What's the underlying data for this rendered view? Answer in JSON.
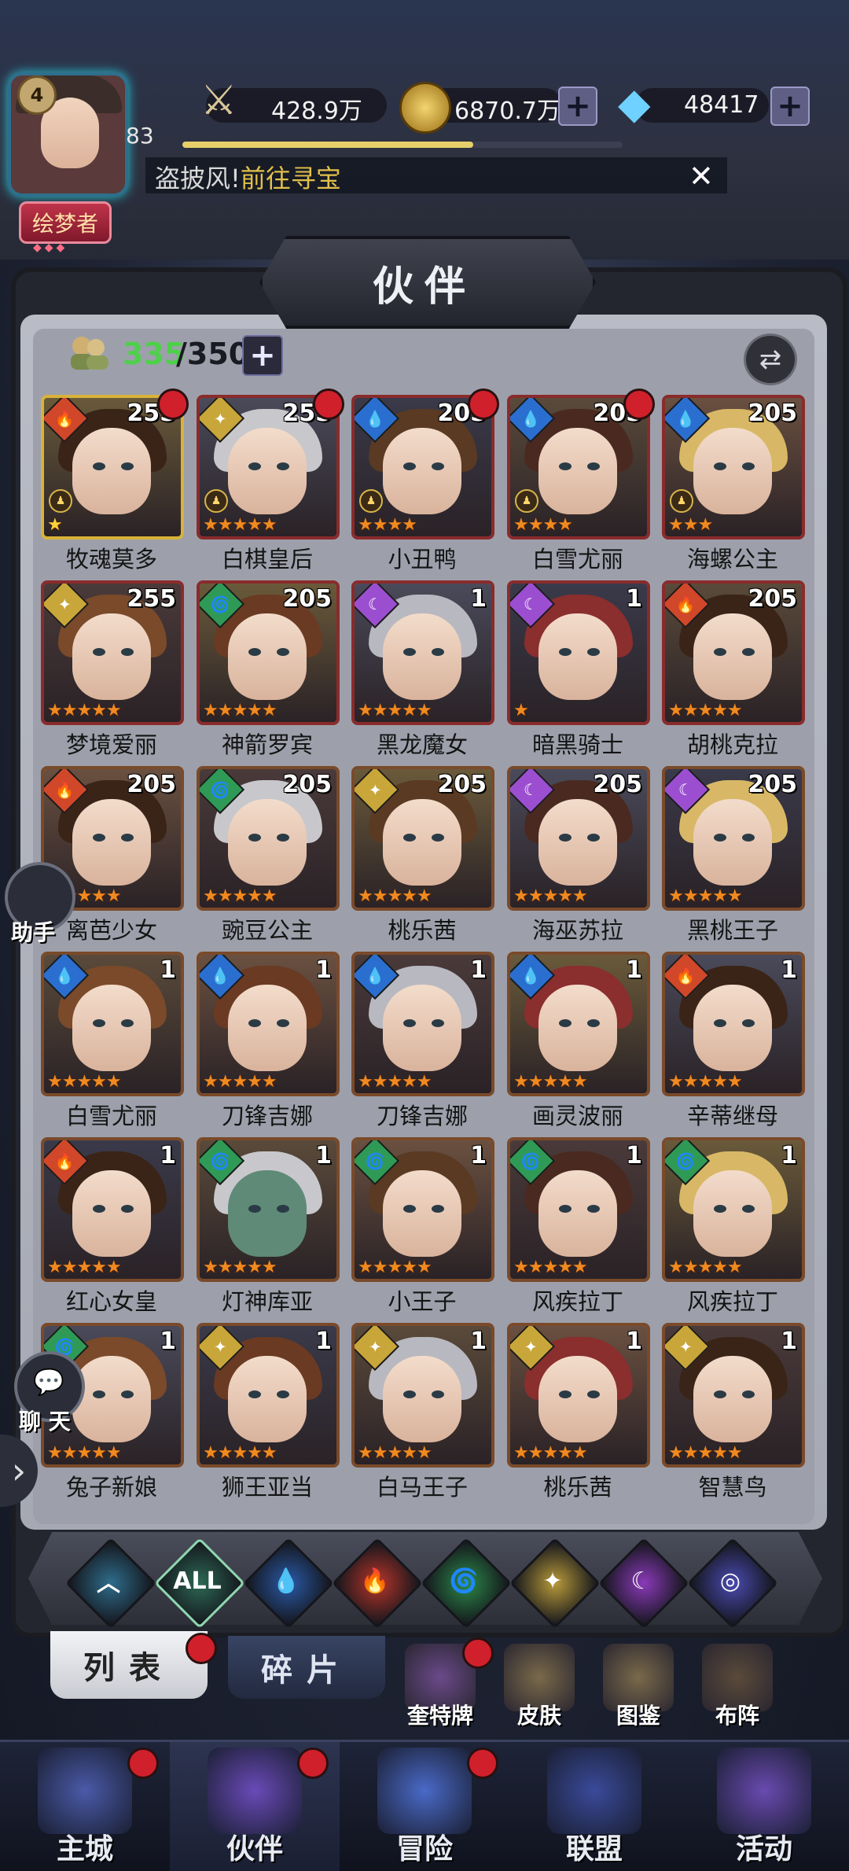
{
  "player": {
    "level": "4",
    "exp_level": "83",
    "title": "绘梦者",
    "exp_progress": 0.66
  },
  "resources": {
    "power": "428.9万",
    "gold": "6870.7万",
    "gems": "48417"
  },
  "ticker": {
    "prefix": "盗披风!",
    "link": "前往寻宝"
  },
  "panel": {
    "title": "伙伴",
    "count_current": "335",
    "count_max": "/350"
  },
  "cards": [
    {
      "name": "牧魂莫多",
      "level": "255",
      "element": "fire",
      "stars": 1,
      "lock": true,
      "dot": true,
      "frame": "gold"
    },
    {
      "name": "白棋皇后",
      "level": "255",
      "element": "light",
      "stars": 5,
      "lock": true,
      "dot": true,
      "frame": "red"
    },
    {
      "name": "小丑鸭",
      "level": "205",
      "element": "water",
      "stars": 4,
      "lock": true,
      "dot": true,
      "frame": "red"
    },
    {
      "name": "白雪尤丽",
      "level": "205",
      "element": "water",
      "stars": 4,
      "lock": true,
      "dot": true,
      "frame": "red"
    },
    {
      "name": "海螺公主",
      "level": "205",
      "element": "water",
      "stars": 3,
      "lock": true,
      "dot": false,
      "frame": "red"
    },
    {
      "name": "梦境爱丽",
      "level": "255",
      "element": "light",
      "stars": 5,
      "lock": false,
      "dot": false,
      "frame": "red"
    },
    {
      "name": "神箭罗宾",
      "level": "205",
      "element": "wind",
      "stars": 5,
      "lock": false,
      "dot": false,
      "frame": "red"
    },
    {
      "name": "黑龙魔女",
      "level": "1",
      "element": "dark",
      "stars": 5,
      "lock": false,
      "dot": false,
      "frame": "red"
    },
    {
      "name": "暗黑骑士",
      "level": "1",
      "element": "dark",
      "stars": 1,
      "lock": false,
      "dot": false,
      "frame": "red"
    },
    {
      "name": "胡桃克拉",
      "level": "205",
      "element": "fire",
      "stars": 5,
      "lock": false,
      "dot": false,
      "frame": "red"
    },
    {
      "name": "离芭少女",
      "level": "205",
      "element": "fire",
      "stars": 5,
      "lock": false,
      "dot": false,
      "frame": "brown"
    },
    {
      "name": "豌豆公主",
      "level": "205",
      "element": "wind",
      "stars": 5,
      "lock": false,
      "dot": false,
      "frame": "brown"
    },
    {
      "name": "桃乐茜",
      "level": "205",
      "element": "light",
      "stars": 5,
      "lock": false,
      "dot": false,
      "frame": "brown"
    },
    {
      "name": "海巫苏拉",
      "level": "205",
      "element": "dark",
      "stars": 5,
      "lock": false,
      "dot": false,
      "frame": "brown"
    },
    {
      "name": "黑桃王子",
      "level": "205",
      "element": "dark",
      "stars": 5,
      "lock": false,
      "dot": false,
      "frame": "brown"
    },
    {
      "name": "白雪尤丽",
      "level": "1",
      "element": "water",
      "stars": 5,
      "lock": false,
      "dot": false,
      "frame": "brown"
    },
    {
      "name": "刀锋吉娜",
      "level": "1",
      "element": "water",
      "stars": 5,
      "lock": false,
      "dot": false,
      "frame": "brown"
    },
    {
      "name": "刀锋吉娜",
      "level": "1",
      "element": "water",
      "stars": 5,
      "lock": false,
      "dot": false,
      "frame": "brown"
    },
    {
      "name": "画灵波丽",
      "level": "1",
      "element": "water",
      "stars": 5,
      "lock": false,
      "dot": false,
      "frame": "brown"
    },
    {
      "name": "辛蒂继母",
      "level": "1",
      "element": "fire",
      "stars": 5,
      "lock": false,
      "dot": false,
      "frame": "brown"
    },
    {
      "name": "红心女皇",
      "level": "1",
      "element": "fire",
      "stars": 5,
      "lock": false,
      "dot": false,
      "frame": "brown"
    },
    {
      "name": "灯神库亚",
      "level": "1",
      "element": "wind",
      "stars": 5,
      "lock": false,
      "dot": false,
      "frame": "brown"
    },
    {
      "name": "小王子",
      "level": "1",
      "element": "wind",
      "stars": 5,
      "lock": false,
      "dot": false,
      "frame": "brown"
    },
    {
      "name": "风疾拉丁",
      "level": "1",
      "element": "wind",
      "stars": 5,
      "lock": false,
      "dot": false,
      "frame": "brown"
    },
    {
      "name": "风疾拉丁",
      "level": "1",
      "element": "wind",
      "stars": 5,
      "lock": false,
      "dot": false,
      "frame": "brown"
    },
    {
      "name": "兔子新娘",
      "level": "1",
      "element": "wind",
      "stars": 5,
      "lock": false,
      "dot": false,
      "frame": "brown"
    },
    {
      "name": "狮王亚当",
      "level": "1",
      "element": "light",
      "stars": 5,
      "lock": false,
      "dot": false,
      "frame": "brown"
    },
    {
      "name": "白马王子",
      "level": "1",
      "element": "light",
      "stars": 5,
      "lock": false,
      "dot": false,
      "frame": "brown"
    },
    {
      "name": "桃乐茜",
      "level": "1",
      "element": "light",
      "stars": 5,
      "lock": false,
      "dot": false,
      "frame": "brown"
    },
    {
      "name": "智慧鸟",
      "level": "1",
      "element": "light",
      "stars": 5,
      "lock": false,
      "dot": false,
      "frame": "brown"
    }
  ],
  "filters": [
    {
      "name": "any",
      "glyph": "︿",
      "color": "#2f6d8c"
    },
    {
      "name": "all",
      "glyph": "ALL",
      "color": "#2d6a55"
    },
    {
      "name": "water",
      "glyph": "💧",
      "color": "#2a5aa8"
    },
    {
      "name": "fire",
      "glyph": "🔥",
      "color": "#b8352a"
    },
    {
      "name": "wind",
      "glyph": "🌀",
      "color": "#2c8a4a"
    },
    {
      "name": "light",
      "glyph": "✦",
      "color": "#b89a3a"
    },
    {
      "name": "dark",
      "glyph": "☾",
      "color": "#8a3ab8"
    },
    {
      "name": "cosmic",
      "glyph": "◎",
      "color": "#4a4ab0"
    }
  ],
  "tabs": {
    "list": "列表",
    "fragments": "碎片"
  },
  "utilities": [
    {
      "label": "奎特牌",
      "dot": true
    },
    {
      "label": "皮肤",
      "dot": false
    },
    {
      "label": "图鉴",
      "dot": false
    },
    {
      "label": "布阵",
      "dot": false
    }
  ],
  "side": {
    "assistant": "助手",
    "chat": "聊 天"
  },
  "nav": [
    {
      "label": "主城",
      "dot": true,
      "active": false
    },
    {
      "label": "伙伴",
      "dot": true,
      "active": true
    },
    {
      "label": "冒险",
      "dot": true,
      "active": false
    },
    {
      "label": "联盟",
      "dot": false,
      "active": false
    },
    {
      "label": "活动",
      "dot": false,
      "active": false
    }
  ],
  "colors": {
    "accent_gold": "#e2c04a",
    "count_green": "#4ed04a",
    "star_orange": "#f08a20",
    "notice_red": "#d0202c"
  }
}
